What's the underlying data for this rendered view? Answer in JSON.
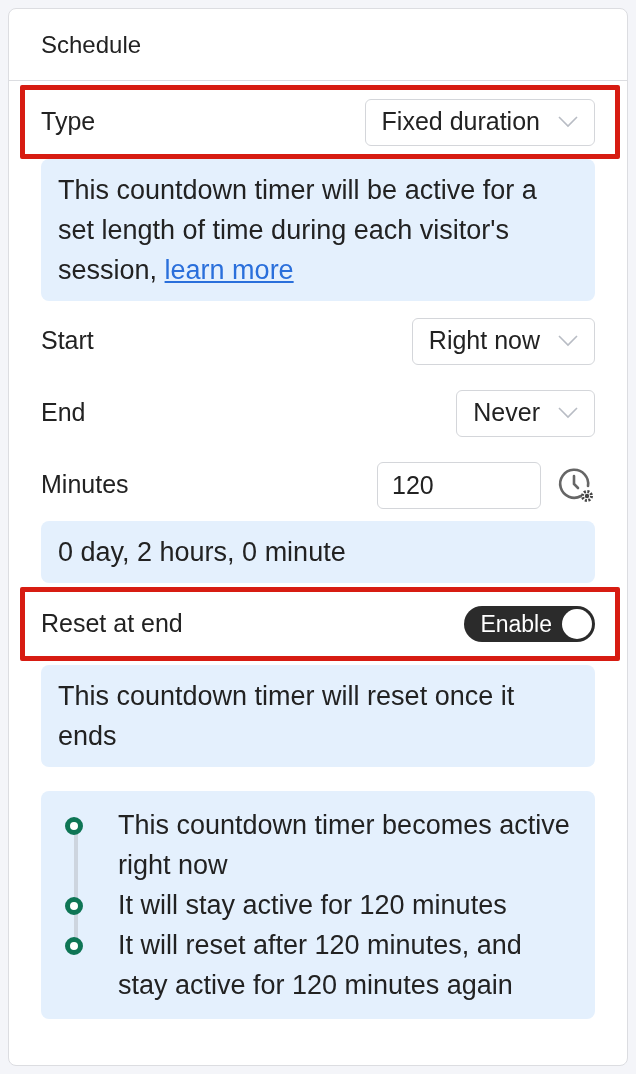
{
  "panel": {
    "title": "Schedule"
  },
  "rows": [
    {
      "kind": "select",
      "label": "Type",
      "value": "Fixed duration",
      "highlighted": true,
      "note": {
        "text": "This countdown timer will be active for a set length of time during each visitor's session,",
        "link": "learn more"
      }
    },
    {
      "kind": "select",
      "label": "Start",
      "value": "Right now",
      "highlighted": false
    },
    {
      "kind": "select",
      "label": "End",
      "value": "Never",
      "highlighted": false
    },
    {
      "kind": "number",
      "label": "Minutes",
      "value": "120",
      "highlighted": false,
      "note": {
        "text": "0 day, 2 hours, 0 minute"
      }
    },
    {
      "kind": "toggle",
      "label": "Reset at end",
      "value": "Enable",
      "on": true,
      "highlighted": true,
      "note": {
        "text": "This countdown timer will reset once it ends"
      }
    }
  ],
  "timeline": [
    {
      "text": "This countdown timer becomes active right now"
    },
    {
      "text": "It will stay active for 120 minutes"
    },
    {
      "text": "It will reset after 120 minutes, and stay active for 120 minutes again"
    }
  ]
}
